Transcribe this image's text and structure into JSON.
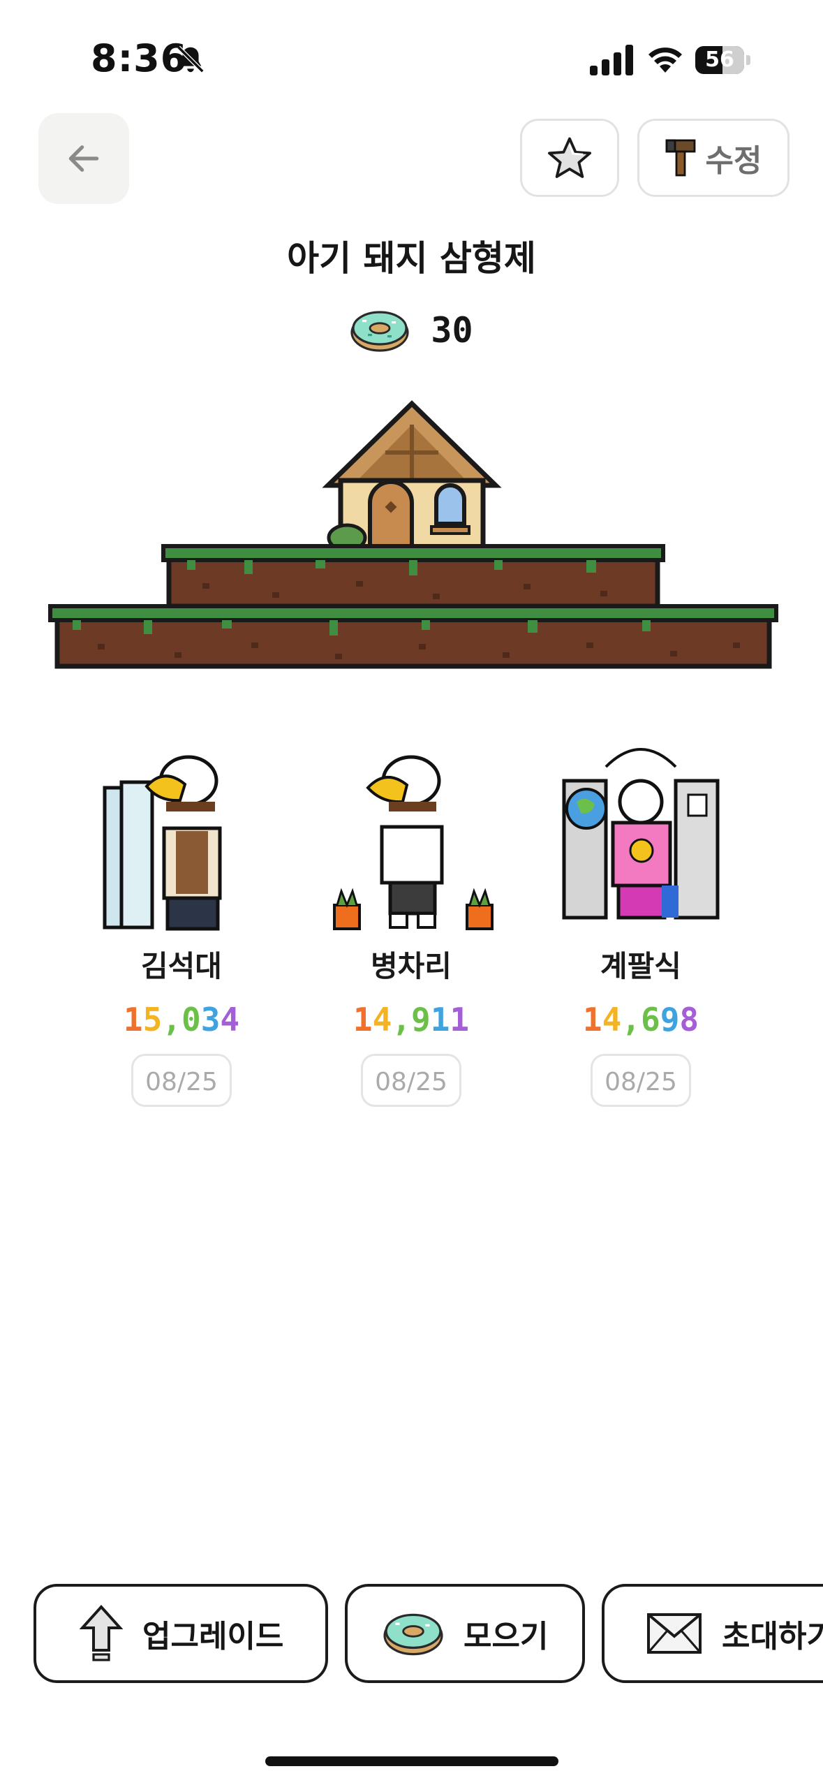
{
  "status_bar": {
    "time": "8:36",
    "battery": "56",
    "icons": [
      "bell-slash-icon",
      "cellular-signal-icon",
      "wifi-icon",
      "battery-icon"
    ]
  },
  "header": {
    "back_icon": "arrow-left-icon",
    "favorite_icon": "star-icon",
    "edit_icon": "hammer-icon",
    "edit_label": "수정"
  },
  "farm": {
    "name": "아기 돼지 삼형제",
    "donut_count": "30",
    "scene": "house-on-grass-platforms"
  },
  "members": [
    {
      "name": "김석대",
      "score": "15,034",
      "date": "08/25"
    },
    {
      "name": "병차리",
      "score": "14,911",
      "date": "08/25"
    },
    {
      "name": "계팔식",
      "score": "14,698",
      "date": "08/25"
    }
  ],
  "score_colors": [
    "#f0712c",
    "#f4b322",
    "#6cc04a",
    "#3fa3e0",
    "#a55fd6"
  ],
  "actions": [
    {
      "label": "업그레이드",
      "icon": "upgrade-arrow-icon"
    },
    {
      "label": "모으기",
      "icon": "donut-icon"
    },
    {
      "label": "초대하기",
      "icon": "envelope-icon"
    }
  ]
}
